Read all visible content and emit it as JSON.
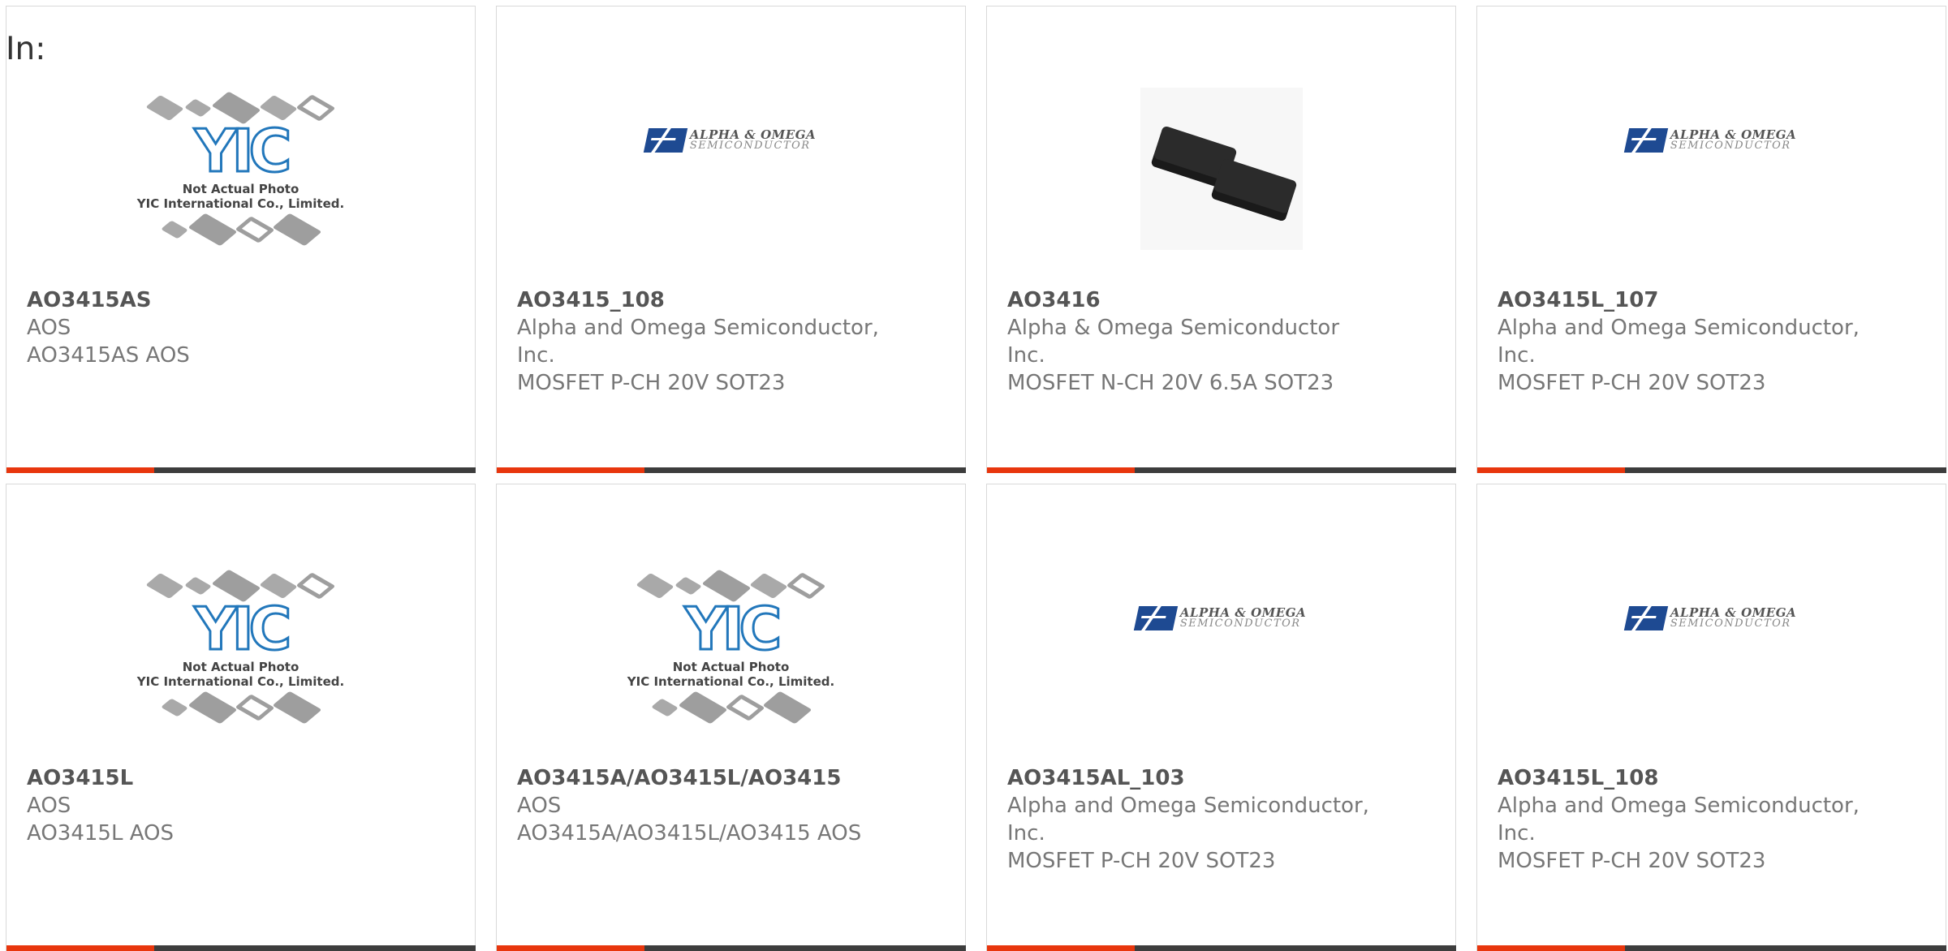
{
  "header": {
    "label": "In:"
  },
  "products": [
    {
      "image": "yic-placeholder",
      "part_number": "AO3415AS",
      "manufacturer": [
        "AOS"
      ],
      "description": "AO3415AS AOS"
    },
    {
      "image": "aos-logo",
      "part_number": "AO3415_108",
      "manufacturer": [
        "Alpha and Omega Semiconductor,",
        "Inc."
      ],
      "description": "MOSFET P-CH 20V SOT23"
    },
    {
      "image": "sot23-photo",
      "part_number": "AO3416",
      "manufacturer": [
        "Alpha & Omega Semiconductor",
        "Inc."
      ],
      "description": "MOSFET N-CH 20V 6.5A SOT23"
    },
    {
      "image": "aos-logo",
      "part_number": "AO3415L_107",
      "manufacturer": [
        "Alpha and Omega Semiconductor,",
        "Inc."
      ],
      "description": "MOSFET P-CH 20V SOT23"
    },
    {
      "image": "yic-placeholder",
      "part_number": "AO3415L",
      "manufacturer": [
        "AOS"
      ],
      "description": "AO3415L AOS"
    },
    {
      "image": "yic-placeholder",
      "part_number": "AO3415A/AO3415L/AO3415",
      "manufacturer": [
        "AOS"
      ],
      "description": "AO3415A/AO3415L/AO3415 AOS"
    },
    {
      "image": "aos-logo",
      "part_number": "AO3415AL_103",
      "manufacturer": [
        "Alpha and Omega Semiconductor,",
        "Inc."
      ],
      "description": "MOSFET P-CH 20V SOT23"
    },
    {
      "image": "aos-logo",
      "part_number": "AO3415L_108",
      "manufacturer": [
        "Alpha and Omega Semiconductor,",
        "Inc."
      ],
      "description": "MOSFET P-CH 20V SOT23"
    }
  ],
  "logos": {
    "aos": {
      "line1": "ALPHA & OMEGA",
      "line2": "SEMICONDUCTOR"
    },
    "yic": {
      "mark": "YIC",
      "caption1": "Not Actual Photo",
      "caption2": "YIC International Co., Limited."
    }
  },
  "colors": {
    "accent": "#e8360d",
    "bar": "#3d3d3d",
    "aos_blue": "#1e4a92",
    "yic_blue": "#2277bb"
  }
}
